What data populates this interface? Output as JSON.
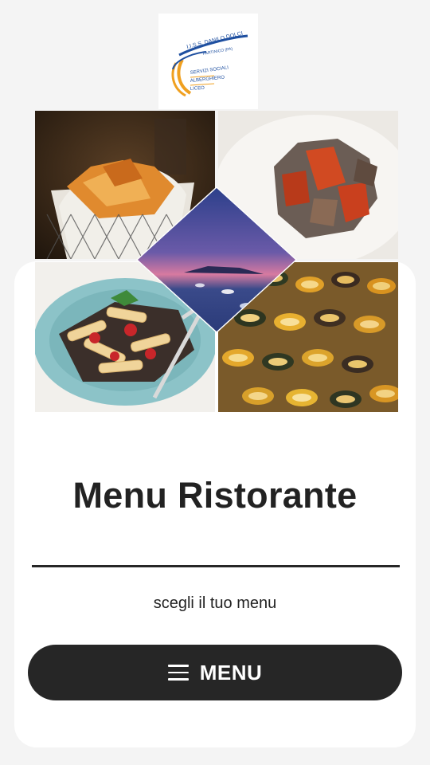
{
  "logo": {
    "line1": "I.I.S.S. DANILO DOLCI",
    "line2": "PARTINICO (PA)",
    "line3": "SERVIZI SOCIALI",
    "line4": "ALBERGHIERO",
    "line5": "LICEO",
    "accent_colors": [
      "#f0a020",
      "#1e4fa0"
    ]
  },
  "collage": {
    "tiles": [
      "fried-pasta-basket-photo",
      "peperonata-photo",
      "pasta-alla-norma-photo",
      "stuffed-vegetables-tray-photo"
    ],
    "center": "sunset-sea-photo"
  },
  "main": {
    "title": "Menu Ristorante",
    "subtitle": "scegli il tuo menu",
    "menu_button_label": "MENU"
  },
  "colors": {
    "background": "#f4f4f4",
    "card": "#ffffff",
    "button": "#262626",
    "text": "#222222"
  }
}
